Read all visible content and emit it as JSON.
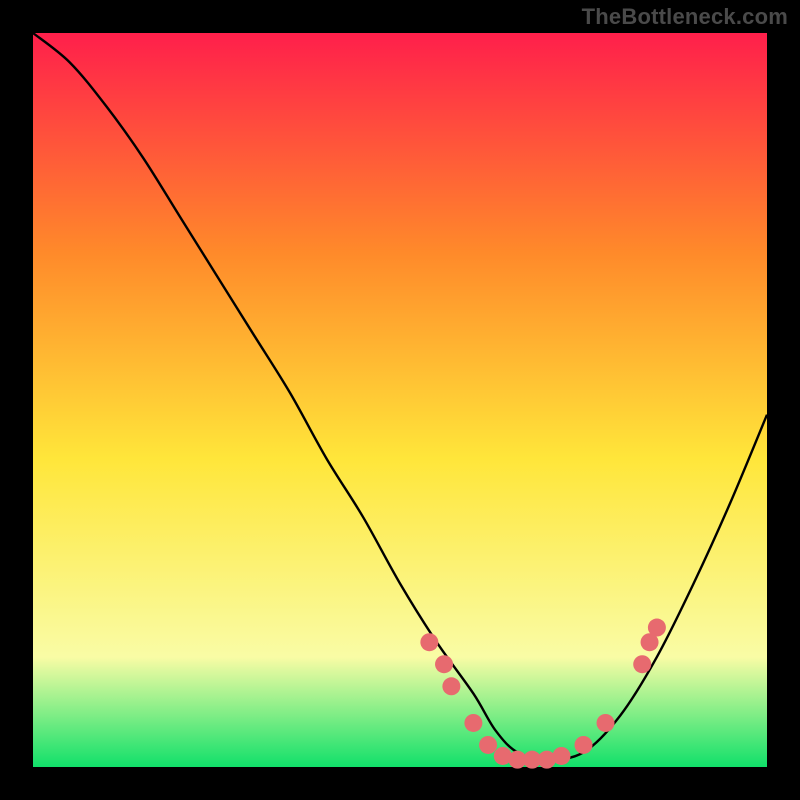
{
  "watermark": "TheBottleneck.com",
  "chart_data": {
    "type": "line",
    "title": "",
    "xlabel": "",
    "ylabel": "",
    "xlim": [
      0,
      100
    ],
    "ylim": [
      0,
      100
    ],
    "background_gradient": {
      "top": "#ff1f4b",
      "upper_mid": "#ff8a2a",
      "mid": "#ffe63a",
      "lower_mid": "#f9fca5",
      "bottom": "#11e06a"
    },
    "series": [
      {
        "name": "bottleneck-curve",
        "x": [
          0,
          5,
          10,
          15,
          20,
          25,
          30,
          35,
          40,
          45,
          50,
          55,
          60,
          63,
          66,
          70,
          75,
          80,
          85,
          90,
          95,
          100
        ],
        "y": [
          100,
          96,
          90,
          83,
          75,
          67,
          59,
          51,
          42,
          34,
          25,
          17,
          10,
          5,
          2,
          1,
          2,
          7,
          15,
          25,
          36,
          48
        ],
        "color": "#000000"
      }
    ],
    "markers": {
      "name": "highlight-points",
      "color": "#e76a6f",
      "radius": 9,
      "points": [
        {
          "x": 54,
          "y": 17
        },
        {
          "x": 56,
          "y": 14
        },
        {
          "x": 57,
          "y": 11
        },
        {
          "x": 60,
          "y": 6
        },
        {
          "x": 62,
          "y": 3
        },
        {
          "x": 64,
          "y": 1.5
        },
        {
          "x": 66,
          "y": 1
        },
        {
          "x": 68,
          "y": 1
        },
        {
          "x": 70,
          "y": 1
        },
        {
          "x": 72,
          "y": 1.5
        },
        {
          "x": 75,
          "y": 3
        },
        {
          "x": 78,
          "y": 6
        },
        {
          "x": 83,
          "y": 14
        },
        {
          "x": 84,
          "y": 17
        },
        {
          "x": 85,
          "y": 19
        }
      ]
    }
  }
}
